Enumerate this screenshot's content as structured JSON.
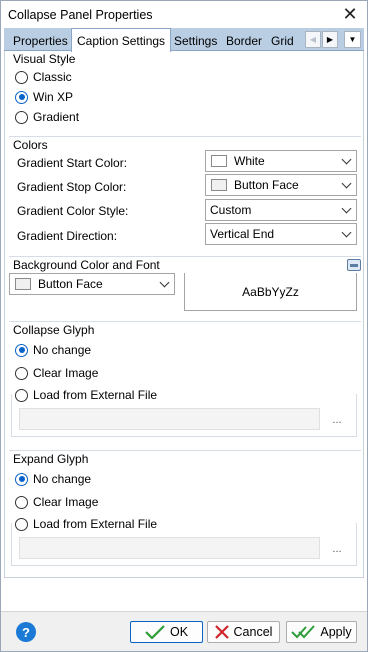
{
  "window": {
    "title": "Collapse Panel Properties"
  },
  "tabs": [
    {
      "label": "Properties",
      "active": false
    },
    {
      "label": "Caption Settings",
      "active": true
    },
    {
      "label": "Settings",
      "active": false
    },
    {
      "label": "Border",
      "active": false
    },
    {
      "label": "Grid",
      "active": false
    }
  ],
  "visual_style": {
    "title": "Visual Style",
    "options": [
      {
        "label": "Classic",
        "checked": false
      },
      {
        "label": "Win XP",
        "checked": true
      },
      {
        "label": "Gradient",
        "checked": false
      }
    ]
  },
  "colors": {
    "title": "Colors",
    "rows": [
      {
        "label": "Gradient Start Color:",
        "value": "White",
        "swatch": "#ffffff"
      },
      {
        "label": "Gradient Stop Color:",
        "value": "Button Face",
        "swatch": "#f0f0f0"
      },
      {
        "label": "Gradient Color Style:",
        "value": "Custom"
      },
      {
        "label": "Gradient Direction:",
        "value": "Vertical End"
      }
    ]
  },
  "background": {
    "title": "Background Color and Font",
    "color_value": "Button Face",
    "color_swatch": "#f0f0f0",
    "font_preview": "AaBbYyZz"
  },
  "collapse_glyph": {
    "title": "Collapse Glyph",
    "options": [
      {
        "label": "No change",
        "checked": true
      },
      {
        "label": "Clear Image",
        "checked": false
      },
      {
        "label": "Load from External File",
        "checked": false
      }
    ],
    "file_value": "",
    "browse_label": "..."
  },
  "expand_glyph": {
    "title": "Expand Glyph",
    "options": [
      {
        "label": "No change",
        "checked": true
      },
      {
        "label": "Clear Image",
        "checked": false
      },
      {
        "label": "Load from External File",
        "checked": false
      }
    ],
    "file_value": "",
    "browse_label": "..."
  },
  "buttons": {
    "help": "?",
    "ok": "OK",
    "cancel": "Cancel",
    "apply": "Apply"
  },
  "icons": {
    "close": "close-icon",
    "help": "help-icon",
    "ok": "check-icon",
    "cancel": "x-icon",
    "apply": "double-check-icon"
  },
  "theme": {
    "tab_strip": "#b9cde3",
    "radio_accent": "#0a63c9",
    "help_blue": "#1b7ad6",
    "ok_check": "#2e9d3a",
    "cancel_x": "#d0262c"
  }
}
